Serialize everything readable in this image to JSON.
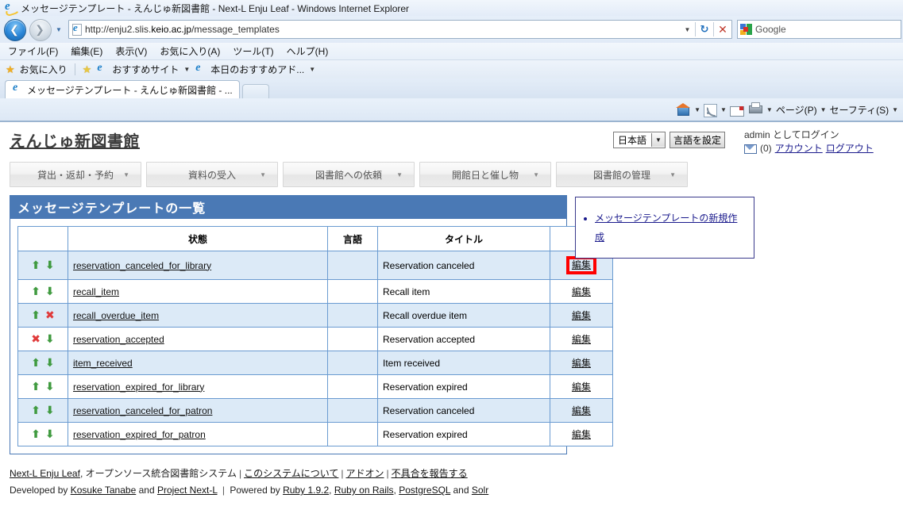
{
  "browser": {
    "title": "メッセージテンプレート - えんじゅ新図書館 - Next-L Enju Leaf - Windows Internet Explorer",
    "url_prefix": "http://enju2.slis.",
    "url_bold": "keio.ac.jp",
    "url_suffix": "/message_templates",
    "search_engine": "Google",
    "menu": [
      "ファイル(F)",
      "編集(E)",
      "表示(V)",
      "お気に入り(A)",
      "ツール(T)",
      "ヘルプ(H)"
    ],
    "favorites": {
      "favorites_label": "お気に入り",
      "suggested_sites": "おすすめサイト",
      "web_slice": "本日のおすすめアド..."
    },
    "tab_label": "メッセージテンプレート - えんじゅ新図書館 - ...",
    "command_bar": {
      "page": "ページ(P)",
      "safety": "セーフティ(S)"
    }
  },
  "site": {
    "title": "えんじゅ新図書館",
    "language": {
      "selected": "日本語",
      "set_button": "言語を設定"
    },
    "user": {
      "login_text": "admin としてログイン",
      "message_count": "(0)",
      "account_link": "アカウント",
      "logout_link": "ログアウト"
    },
    "nav": [
      {
        "label": "貸出・返却・予約"
      },
      {
        "label": "資料の受入"
      },
      {
        "label": "図書館への依頼"
      },
      {
        "label": "開館日と催し物"
      },
      {
        "label": "図書館の管理"
      }
    ]
  },
  "main": {
    "heading": "メッセージテンプレートの一覧",
    "columns": [
      "",
      "状態",
      "言語",
      "タイトル",
      ""
    ],
    "rows": [
      {
        "up": "⬆",
        "down": "⬇",
        "state": "reservation_canceled_for_library",
        "lang": "",
        "title": "Reservation canceled",
        "edit": "編集",
        "highlighted": true
      },
      {
        "up": "⬆",
        "down": "⬇",
        "state": "recall_item",
        "lang": "",
        "title": "Recall item",
        "edit": "編集",
        "highlighted": false
      },
      {
        "up": "⬆",
        "down": "✖",
        "state": "recall_overdue_item",
        "lang": "",
        "title": "Recall overdue item",
        "edit": "編集",
        "highlighted": false
      },
      {
        "up": "✖",
        "down": "⬇",
        "state": "reservation_accepted",
        "lang": "",
        "title": "Reservation accepted",
        "edit": "編集",
        "highlighted": false
      },
      {
        "up": "⬆",
        "down": "⬇",
        "state": "item_received",
        "lang": "",
        "title": "Item received",
        "edit": "編集",
        "highlighted": false
      },
      {
        "up": "⬆",
        "down": "⬇",
        "state": "reservation_expired_for_library",
        "lang": "",
        "title": "Reservation expired",
        "edit": "編集",
        "highlighted": false
      },
      {
        "up": "⬆",
        "down": "⬇",
        "state": "reservation_canceled_for_patron",
        "lang": "",
        "title": "Reservation canceled",
        "edit": "編集",
        "highlighted": false
      },
      {
        "up": "⬆",
        "down": "⬇",
        "state": "reservation_expired_for_patron",
        "lang": "",
        "title": "Reservation expired",
        "edit": "編集",
        "highlighted": false
      }
    ]
  },
  "sidebar": {
    "items": [
      {
        "label": "メッセージテンプレートの新規作成"
      }
    ]
  },
  "footer": {
    "line1": {
      "product": "Next-L Enju Leaf",
      "desc": ", オープンソース統合図書館システム",
      "about": "このシステムについて",
      "addon": "アドオン",
      "bug": "不具合を報告する"
    },
    "line2": {
      "developed_by": "Developed by",
      "author": "Kosuke Tanabe",
      "and": "and",
      "project": "Project Next-L",
      "powered_by": "Powered by",
      "ruby": "Ruby 1.9.2",
      "rails": "Ruby on Rails",
      "pg": "PostgreSQL",
      "and2": "and",
      "solr": "Solr"
    }
  },
  "colors": {
    "header_blue": "#4a79b5",
    "row_blue": "#dceaf7",
    "highlight_red": "#ff0000",
    "arrow_green": "#3f9a3f",
    "arrow_red": "#e03a3a"
  }
}
